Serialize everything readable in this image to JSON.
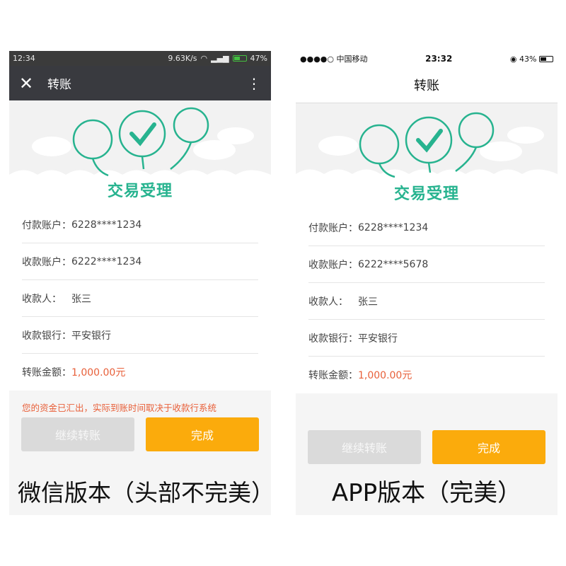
{
  "wechat": {
    "status_time": "12:34",
    "status_speed": "9.63K/s",
    "status_battery": "47%",
    "close_label": "✕",
    "title": "转账",
    "more_label": "⋮",
    "banner_text": "交易受理",
    "rows": [
      {
        "label": "付款账户：",
        "value": "6228****1234"
      },
      {
        "label": "收款账户：",
        "value": "6222****1234"
      },
      {
        "label": "收款人：",
        "value": "张三"
      },
      {
        "label": "收款银行：",
        "value": "平安银行"
      },
      {
        "label": "转账金额：",
        "value": "1,000.00元"
      }
    ],
    "notice": "您的资金已汇出，实际到账时间取决于收款行系统",
    "btn_continue": "继续转账",
    "btn_done": "完成",
    "caption": "微信版本（头部不完美）"
  },
  "app": {
    "status_carrier": "●●●●○ 中国移动",
    "status_time": "23:32",
    "status_battery": "43%",
    "title": "转账",
    "banner_text": "交易受理",
    "rows": [
      {
        "label": "付款账户：",
        "value": "6228****1234"
      },
      {
        "label": "收款账户：",
        "value": "6222****5678"
      },
      {
        "label": "收款人：",
        "value": "张三"
      },
      {
        "label": "收款银行：",
        "value": "平安银行"
      },
      {
        "label": "转账金额：",
        "value": "1,000.00元"
      }
    ],
    "btn_continue": "继续转账",
    "btn_done": "完成",
    "caption": "APP版本（完美）"
  },
  "colors": {
    "accent_green": "#27b38f",
    "button_orange": "#fbab0c",
    "alert_red": "#e8603a"
  }
}
